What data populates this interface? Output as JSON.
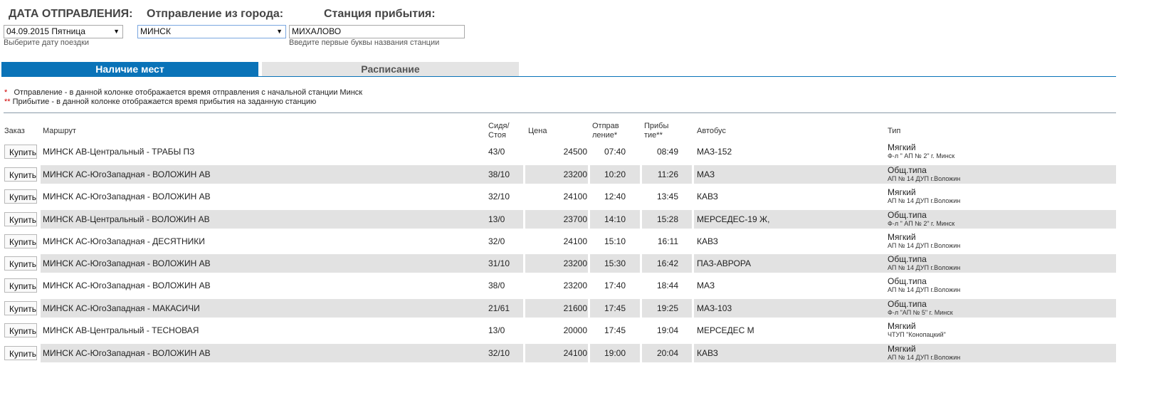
{
  "filters": {
    "date_label": "ДАТА ОТПРАВЛЕНИЯ:",
    "date_value": "04.09.2015 Пятница",
    "date_hint": "Выберите дату поездки",
    "from_label": "Отправление из города:",
    "from_value": "МИНСК",
    "to_label": "Станция прибытия:",
    "to_value": "МИХАЛОВО",
    "to_hint": "Введите первые буквы названия станции"
  },
  "tabs": [
    {
      "label": "Наличие мест",
      "active": true
    },
    {
      "label": "Расписание",
      "active": false
    }
  ],
  "notes": [
    {
      "star": "*",
      "text": "Отправление - в данной колонке отображается время отправления с начальной станции Минск"
    },
    {
      "star": "**",
      "text": "Прибытие - в данной колонке отображается время прибытия на заданную станцию"
    }
  ],
  "table": {
    "headers": {
      "order": "Заказ",
      "route": "Маршрут",
      "seats_1": "Сидя/",
      "seats_2": "Стоя",
      "price": "Цена",
      "dep_1": "Отправ",
      "dep_2": "ление*",
      "arr_1": "Прибы",
      "arr_2": "тие**",
      "bus": "Автобус",
      "type": "Тип"
    },
    "buy_label": "Купить",
    "rows": [
      {
        "route": "МИНСК АВ-Центральный - ТРАБЫ ПЗ",
        "seats": "43/0",
        "price": "24500",
        "dep": "07:40",
        "arr": "08:49",
        "bus": "МАЗ-152",
        "type": "Мягкий",
        "carrier": "Ф-л \" АП № 2\" г. Минск"
      },
      {
        "route": "МИНСК АС-ЮгоЗападная - ВОЛОЖИН АВ",
        "seats": "38/10",
        "price": "23200",
        "dep": "10:20",
        "arr": "11:26",
        "bus": "МАЗ",
        "type": "Общ.типа",
        "carrier": "АП № 14 ДУП г.Воложин"
      },
      {
        "route": "МИНСК АС-ЮгоЗападная - ВОЛОЖИН АВ",
        "seats": "32/10",
        "price": "24100",
        "dep": "12:40",
        "arr": "13:45",
        "bus": "КАВЗ",
        "type": "Мягкий",
        "carrier": "АП № 14 ДУП г.Воложин"
      },
      {
        "route": "МИНСК АВ-Центральный - ВОЛОЖИН АВ",
        "seats": "13/0",
        "price": "23700",
        "dep": "14:10",
        "arr": "15:28",
        "bus": "МЕРСЕДЕС-19 Ж,",
        "type": "Общ.типа",
        "carrier": "Ф-л \" АП № 2\" г. Минск"
      },
      {
        "route": "МИНСК АС-ЮгоЗападная - ДЕСЯТНИКИ",
        "seats": "32/0",
        "price": "24100",
        "dep": "15:10",
        "arr": "16:11",
        "bus": "КАВЗ",
        "type": "Мягкий",
        "carrier": "АП № 14 ДУП г.Воложин"
      },
      {
        "route": "МИНСК АС-ЮгоЗападная - ВОЛОЖИН АВ",
        "seats": "31/10",
        "price": "23200",
        "dep": "15:30",
        "arr": "16:42",
        "bus": "ПАЗ-АВРОРА",
        "type": "Общ.типа",
        "carrier": "АП № 14 ДУП г.Воложин"
      },
      {
        "route": "МИНСК АС-ЮгоЗападная - ВОЛОЖИН АВ",
        "seats": "38/0",
        "price": "23200",
        "dep": "17:40",
        "arr": "18:44",
        "bus": "МАЗ",
        "type": "Общ.типа",
        "carrier": "АП № 14 ДУП г.Воложин"
      },
      {
        "route": "МИНСК АС-ЮгоЗападная - МАКАСИЧИ",
        "seats": "21/61",
        "price": "21600",
        "dep": "17:45",
        "arr": "19:25",
        "bus": "МАЗ-103",
        "type": "Общ.типа",
        "carrier": "Ф-л \"АП № 5\" г. Минск"
      },
      {
        "route": "МИНСК АВ-Центральный - ТЕСНОВАЯ",
        "seats": "13/0",
        "price": "20000",
        "dep": "17:45",
        "arr": "19:04",
        "bus": "МЕРСЕДЕС М",
        "type": "Мягкий",
        "carrier": "ЧТУП \"Конопацкий\""
      },
      {
        "route": "МИНСК АС-ЮгоЗападная - ВОЛОЖИН АВ",
        "seats": "32/10",
        "price": "24100",
        "dep": "19:00",
        "arr": "20:04",
        "bus": "КАВЗ",
        "type": "Мягкий",
        "carrier": "АП № 14 ДУП г.Воложин"
      }
    ]
  },
  "colors": {
    "active_tab": "#0a73b8",
    "inactive_tab": "#e4e4e4",
    "row_stripe": "#e2e2e2",
    "note_star": "#d00000"
  }
}
